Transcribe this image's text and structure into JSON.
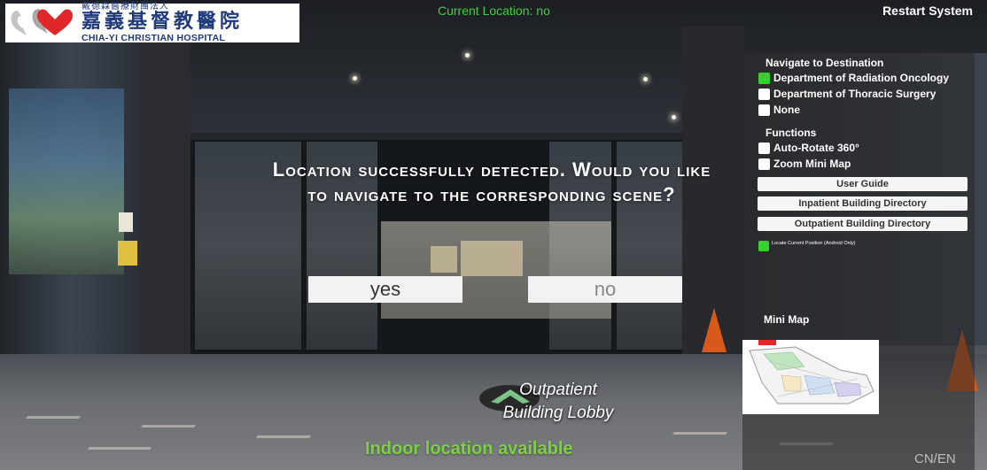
{
  "header": {
    "logo_top": "戴德森醫療財團法人",
    "logo_cn": "嘉義基督教醫院",
    "logo_en": "CHIA-YI CHRISTIAN HOSPITAL",
    "current_location": "Current Location: no",
    "restart_label": "Restart System"
  },
  "panel": {
    "navigate_heading": "Navigate to Destination",
    "destinations": [
      {
        "label": "Department of Radiation Oncology",
        "checked": true
      },
      {
        "label": "Department of Thoracic Surgery",
        "checked": false
      },
      {
        "label": "None",
        "checked": false
      }
    ],
    "functions_heading": "Functions",
    "functions": [
      {
        "label": "Auto-Rotate 360°",
        "checked": false
      },
      {
        "label": "Zoom Mini Map",
        "checked": false
      }
    ],
    "buttons": [
      "User Guide",
      "Inpatient Building Directory",
      "Outpatient Building Directory"
    ],
    "locate_label": "Locate Current Position (Android Only)",
    "minimap_label": "Mini Map"
  },
  "dialog": {
    "message": "Location successfully detected. Would you like to navigate to the corresponding scene?",
    "yes_label": "yes",
    "no_label": "no"
  },
  "scene": {
    "hotspot_label": "Outpatient Building Lobby",
    "indoor_status": "Indoor location available",
    "language_toggle": "CN/EN"
  },
  "colors": {
    "accent_green": "#36d12f",
    "status_green": "#7dd142",
    "logo_blue": "#1e3a7a",
    "logo_red": "#e0282a"
  }
}
